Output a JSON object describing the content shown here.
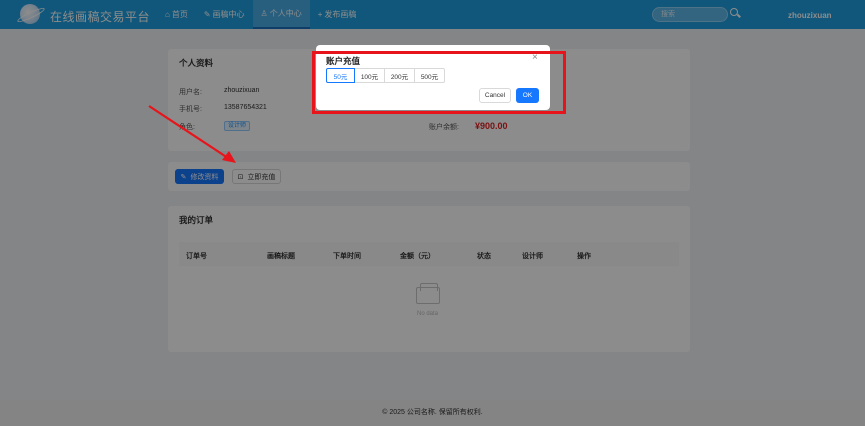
{
  "header": {
    "brand": "在线画稿交易平台",
    "nav": [
      {
        "icon": "⌂",
        "label": "首页"
      },
      {
        "icon": "✎",
        "label": "画稿中心"
      },
      {
        "icon": "♙",
        "label": "个人中心"
      },
      {
        "icon": "+",
        "label": "发布画稿"
      }
    ],
    "search_placeholder": "搜索",
    "username": "zhouzixuan"
  },
  "profile": {
    "title": "个人资料",
    "username_label": "用户名:",
    "username_value": "zhouzixuan",
    "phone_label": "手机号:",
    "phone_value": "13587654321",
    "role_label": "角色:",
    "role_value": "设计师",
    "balance_label": "账户余额:",
    "balance_value": "¥900.00"
  },
  "actions": {
    "edit_label": "修改资料",
    "recharge_label": "立即充值"
  },
  "orders": {
    "title": "我的订单",
    "columns": [
      "订单号",
      "画稿标题",
      "下单时间",
      "金额（元）",
      "状态",
      "设计师",
      "操作"
    ],
    "empty_text": "No data"
  },
  "footer": {
    "text": "© 2025 公司名称. 保留所有权利."
  },
  "modal": {
    "title": "账户充值",
    "close": "×",
    "options": [
      "50元",
      "100元",
      "200元",
      "500元"
    ],
    "selected": "50元",
    "cancel_label": "Cancel",
    "ok_label": "OK"
  },
  "colors": {
    "header": "#1f9fe0",
    "primary": "#1677ff",
    "balance": "#e02020",
    "annotation": "#e8141b"
  }
}
